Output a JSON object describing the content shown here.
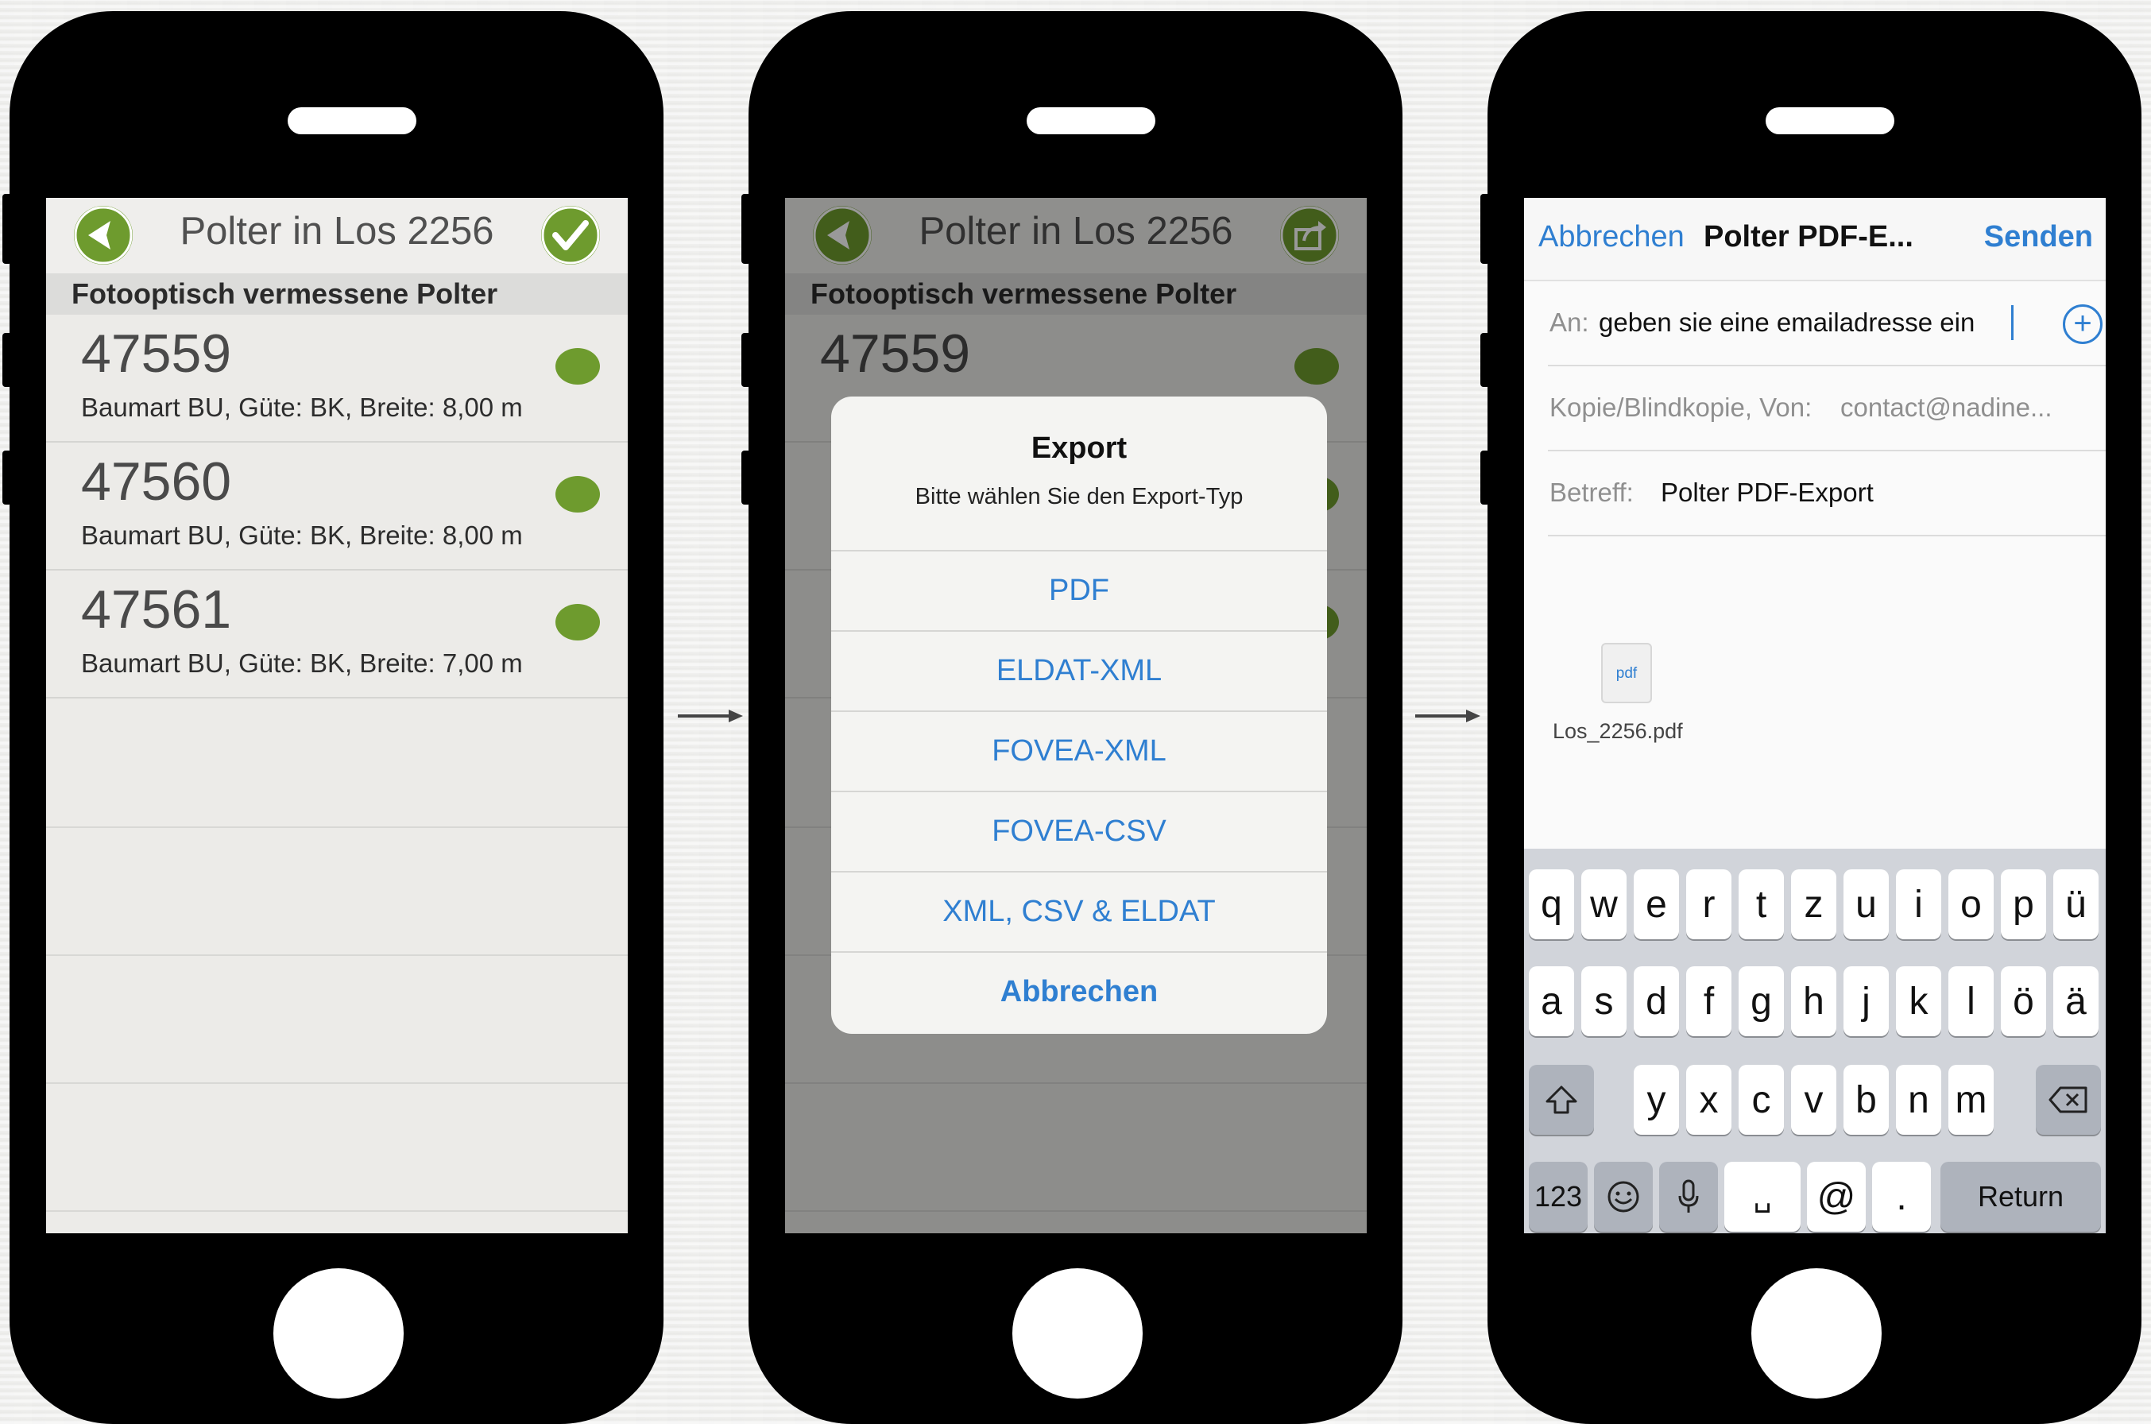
{
  "colors": {
    "accent_green": "#6e9b2e",
    "ios_blue": "#2f7fd1",
    "phone_body": "#000000"
  },
  "screen1": {
    "title": "Polter in Los 2256",
    "back_icon": "arrow-left-icon",
    "confirm_icon": "checkmark-icon",
    "section_header": "Fotooptisch vermessene Polter",
    "items": [
      {
        "number": "47559",
        "description": "Baumart BU, Güte: BK, Breite: 8,00 m"
      },
      {
        "number": "47560",
        "description": "Baumart BU, Güte: BK, Breite: 8,00 m"
      },
      {
        "number": "47561",
        "description": "Baumart BU, Güte: BK, Breite: 7,00 m"
      }
    ]
  },
  "screen2": {
    "title": "Polter in Los 2256",
    "share_icon": "share-icon",
    "section_header": "Fotooptisch vermessene Polter",
    "visible_item_number": "47559",
    "export_dialog": {
      "title": "Export",
      "message": "Bitte wählen Sie den Export-Typ",
      "options": [
        "PDF",
        "ELDAT-XML",
        "FOVEA-XML",
        "FOVEA-CSV",
        "XML, CSV & ELDAT"
      ],
      "cancel": "Abbrechen"
    }
  },
  "screen3": {
    "cancel": "Abbrechen",
    "title": "Polter PDF-E...",
    "send": "Senden",
    "to_label": "An:",
    "to_value": "geben sie eine emailadresse ein",
    "cc_label": "Kopie/Blindkopie, Von:",
    "cc_value": "contact@nadine...",
    "subject_label": "Betreff:",
    "subject_value": "Polter PDF-Export",
    "attachment_type": "pdf",
    "attachment_name": "Los_2256.pdf",
    "keyboard": {
      "row1": [
        "q",
        "w",
        "e",
        "r",
        "t",
        "z",
        "u",
        "i",
        "o",
        "p",
        "ü"
      ],
      "row2": [
        "a",
        "s",
        "d",
        "f",
        "g",
        "h",
        "j",
        "k",
        "l",
        "ö",
        "ä"
      ],
      "row3": [
        "y",
        "x",
        "c",
        "v",
        "b",
        "n",
        "m"
      ],
      "numbers": "123",
      "space": "␣",
      "at": "@",
      "dot": ".",
      "return": "Return"
    }
  }
}
